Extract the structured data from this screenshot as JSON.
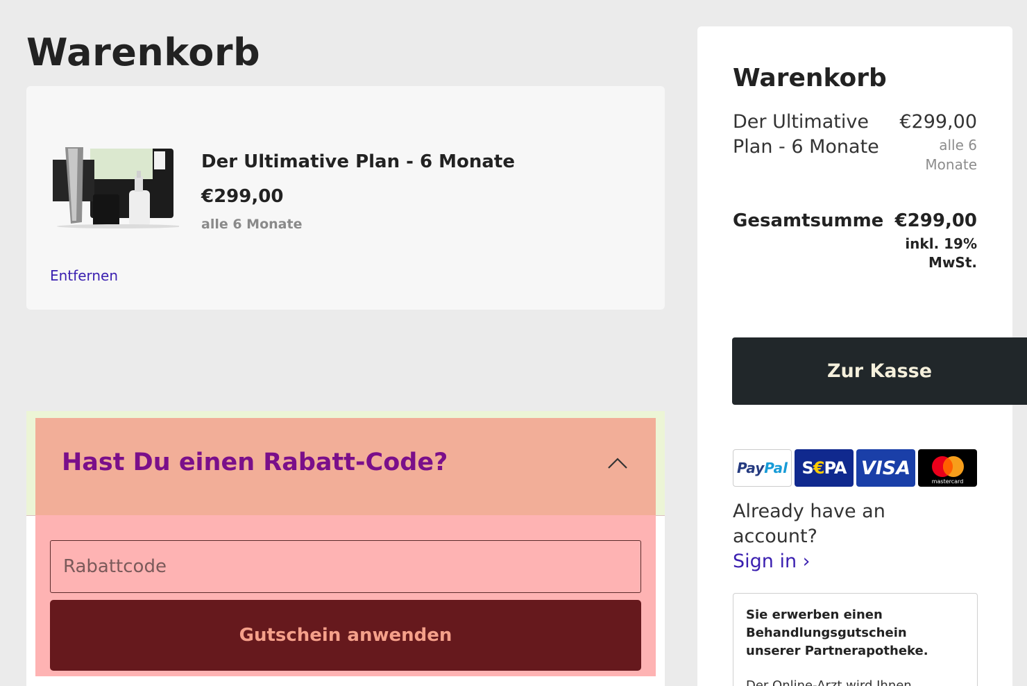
{
  "cart": {
    "page_title": "Warenkorb",
    "item": {
      "name": "Der Ultimative Plan - 6 Monate",
      "price": "€299,00",
      "interval": "alle 6 Monate",
      "remove_label": "Entfernen"
    }
  },
  "discount": {
    "title": "Hast Du einen Rabatt-Code?",
    "placeholder": "Rabattcode",
    "apply_label": "Gutschein anwenden"
  },
  "summary": {
    "title": "Warenkorb",
    "item_name": "Der Ultimative Plan - 6 Monate",
    "item_price": "€299,00",
    "item_interval": "alle 6 Monate",
    "total_label": "Gesamtsumme",
    "total_value": "€299,00",
    "vat_note": "inkl. 19% MwSt.",
    "checkout_label": "Zur Kasse",
    "payment_methods": [
      "PayPal",
      "SEPA",
      "VISA",
      "mastercard"
    ],
    "account_prompt": "Already have an account?",
    "signin_label": "Sign in ›",
    "notice": "Sie erwerben einen Behandlungsgutschein unserer Partnerapotheke.",
    "notice_cut": "Der Online-Arzt wird Ihnen"
  },
  "colors": {
    "background": "#ebebeb",
    "link": "#3a1fb0",
    "discount_header": "#f2ae98",
    "discount_title": "#7a0f8a",
    "discount_body": "#feb3b3",
    "apply_button": "#66191d",
    "checkout_button": "#21272a"
  }
}
